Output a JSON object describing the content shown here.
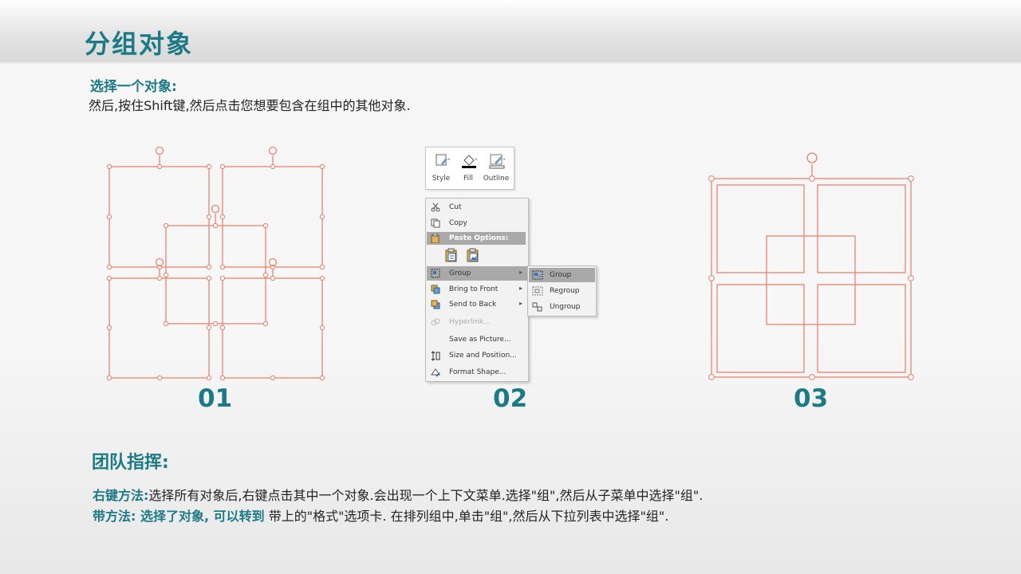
{
  "slide": {
    "title": "分组对象",
    "select_heading": "选择一个对象:",
    "select_text": "然后,按住Shift键,然后点击您想要包含在组中的其他对象.",
    "steps": [
      "01",
      "02",
      "03"
    ]
  },
  "ribbon": {
    "buttons": [
      {
        "label": "Style",
        "icon": "style-icon"
      },
      {
        "label": "Fill",
        "icon": "fill-bucket-icon"
      },
      {
        "label": "Outline",
        "icon": "outline-pen-icon"
      }
    ]
  },
  "context_menu": {
    "items": [
      {
        "label": "Cut",
        "icon": "scissors-icon",
        "disabled": false
      },
      {
        "label": "Copy",
        "icon": "copy-icon",
        "disabled": false
      },
      {
        "label": "Group",
        "icon": "group-icon",
        "disabled": false,
        "highlighted": true,
        "submenu": true
      },
      {
        "label": "Bring to Front",
        "icon": "bring-front-icon",
        "disabled": false,
        "submenu": true
      },
      {
        "label": "Send to Back",
        "icon": "send-back-icon",
        "disabled": false,
        "submenu": true
      },
      {
        "label": "Hyperlink...",
        "icon": "hyperlink-icon",
        "disabled": true
      },
      {
        "label": "Save as Picture...",
        "icon": "",
        "disabled": false
      },
      {
        "label": "Size and Position...",
        "icon": "size-position-icon",
        "disabled": false
      },
      {
        "label": "Format Shape...",
        "icon": "format-shape-icon",
        "disabled": false
      }
    ],
    "paste_options_label": "Paste Options:"
  },
  "submenu": {
    "items": [
      {
        "label": "Group",
        "highlighted": true
      },
      {
        "label": "Regroup",
        "highlighted": false
      },
      {
        "label": "Ungroup",
        "highlighted": false
      }
    ]
  },
  "tips": {
    "heading": "团队指挥:",
    "right_click_label": "右键方法:",
    "right_click_text": "选择所有对象后,右键点击其中一个对象.会出现一个上下文菜单.选择\"组\",然后从子菜单中选择\"组\".",
    "ribbon_label": "带方法: 选择了对象, 可以转到",
    "ribbon_text": " 带上的\"格式\"选项卡. 在排列组中,单击\"组\",然后从下拉列表中选择\"组\"."
  },
  "colors": {
    "accent": "#1c7a86",
    "shape_outline": "#e8846f"
  }
}
